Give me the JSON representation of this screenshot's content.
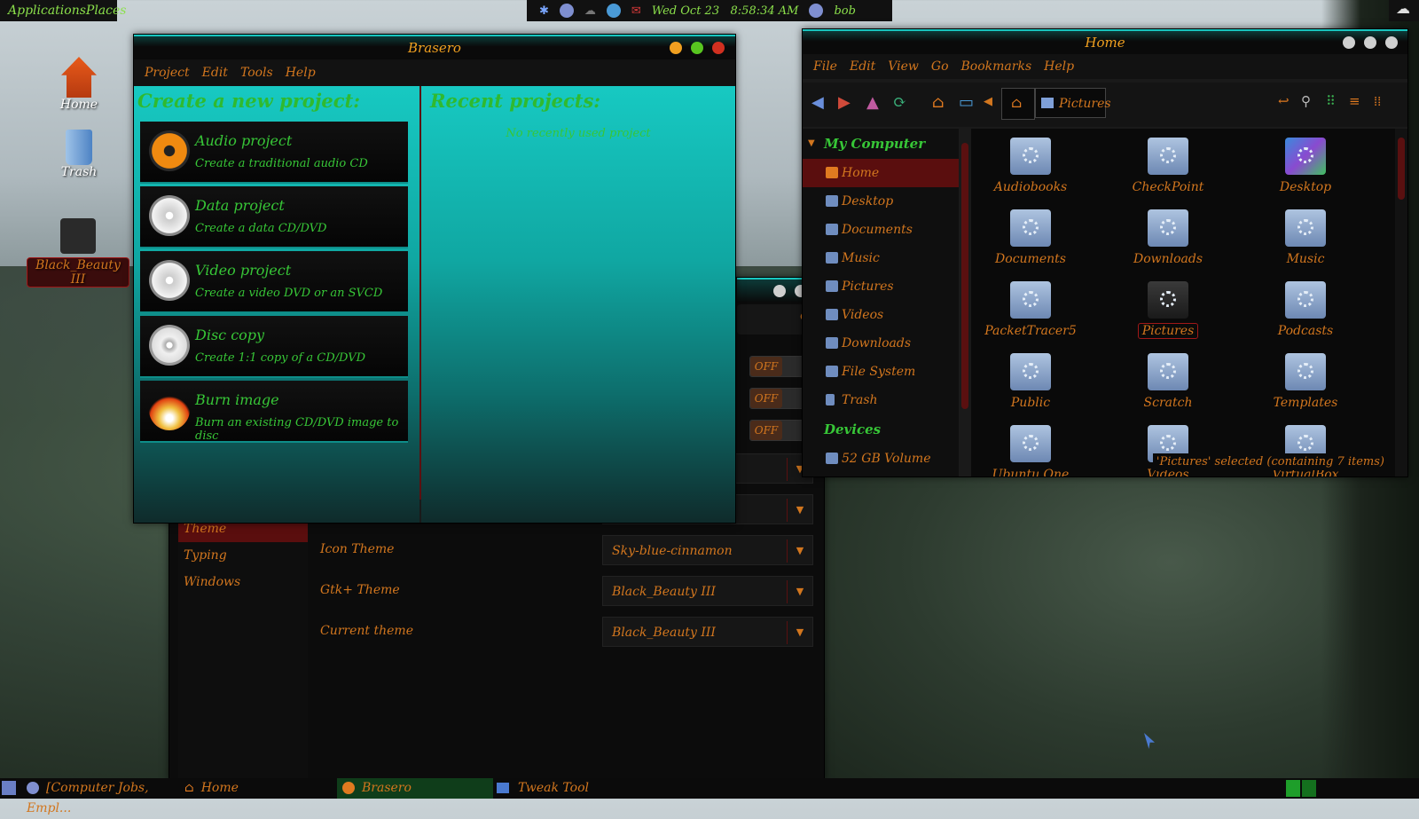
{
  "top_panel": {
    "applications_label": "ApplicationsPlaces",
    "clock": "Wed Oct 23   8:58:34 AM",
    "user": "bob"
  },
  "desktop": {
    "icons": [
      {
        "label": "Home"
      },
      {
        "label": "Trash"
      },
      {
        "label": "Black_Beauty III"
      }
    ]
  },
  "brasero": {
    "title": "Brasero",
    "menu": [
      "Project",
      "Edit",
      "Tools",
      "Help"
    ],
    "create_heading": "Create a new project:",
    "recent_heading": "Recent projects:",
    "no_recent": "No recently used project",
    "projects": [
      {
        "title": "Audio project",
        "desc": "Create a traditional audio CD"
      },
      {
        "title": "Data project",
        "desc": "Create a data CD/DVD"
      },
      {
        "title": "Video project",
        "desc": "Create a video DVD or an SVCD"
      },
      {
        "title": "Disc copy",
        "desc": "Create 1:1 copy of a CD/DVD"
      },
      {
        "title": "Burn image",
        "desc": "Burn an existing CD/DVD image to disc"
      }
    ]
  },
  "tweak_tool": {
    "toggle_label": "OFF",
    "sidebar": [
      "Theme",
      "Typing",
      "Windows"
    ],
    "rows": [
      {
        "label": "Icon Theme",
        "value": "Sky-blue-cinnamon"
      },
      {
        "label": "Gtk+ Theme",
        "value": "Black_Beauty III"
      },
      {
        "label": "Current theme",
        "value": "Black_Beauty III"
      }
    ]
  },
  "file_manager": {
    "title": "Home",
    "menu": [
      "File",
      "Edit",
      "View",
      "Go",
      "Bookmarks",
      "Help"
    ],
    "breadcrumb": "Pictures",
    "sidebar_header": "My Computer",
    "sidebar_items": [
      "Home",
      "Desktop",
      "Documents",
      "Music",
      "Pictures",
      "Videos",
      "Downloads",
      "File System",
      "Trash"
    ],
    "devices_header": "Devices",
    "device_item": "52 GB Volume",
    "files": [
      "Audiobooks",
      "CheckPoint",
      "Desktop",
      "Documents",
      "Downloads",
      "Music",
      "PacketTracer5",
      "Pictures",
      "Podcasts",
      "Public",
      "Scratch",
      "Templates",
      "Ubuntu One",
      "Videos",
      "VirtualBox VMs"
    ],
    "status": "'Pictures' selected (containing 7 items)"
  },
  "taskbar": {
    "items": [
      "[Computer Jobs, Empl...",
      "Home",
      "Brasero",
      "Tweak Tool"
    ]
  },
  "colors": {
    "accent_teal": "#17c9c2",
    "text_orange": "#d2761e",
    "text_green": "#37c637"
  }
}
